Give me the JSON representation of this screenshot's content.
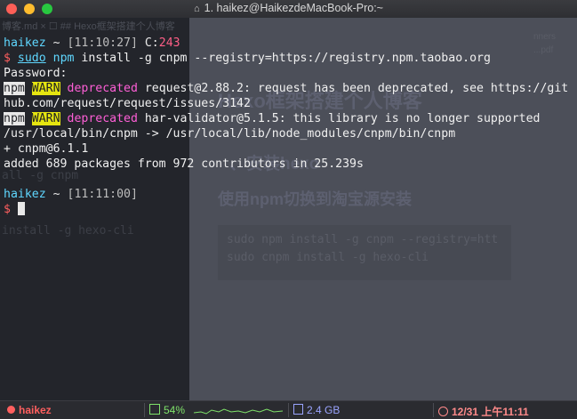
{
  "window": {
    "title": "1. haikez@HaikezdeMacBook-Pro:~",
    "home_icon": "house-icon"
  },
  "background_editor": {
    "tab_text": "博客.md ×   ☐ ## Hexo框架搭建个人博客",
    "right_top_small": "nners",
    "right_top_small2": "...pdf",
    "heading1": "Hexo框架搭建个人博客",
    "heading2": "、安装hexo",
    "heading3": "使用npm切换到淘宝源安装",
    "code_line1": "sudo npm install -g cnpm --registry=htt",
    "code_line2": "sudo cnpm install -g hexo-cli",
    "left_fragment1": "all -g cnpm",
    "left_fragment2": "install -g hexo-cli"
  },
  "terminal": {
    "prompt1": {
      "user": "haikez",
      "path": "~",
      "time": "[11:10:27]",
      "c_label": "C:",
      "c_value": "243"
    },
    "command": {
      "dollar": "$",
      "sudo": "sudo",
      "npm": "npm",
      "rest": " install -g cnpm --registry=https://registry.npm.taobao.org"
    },
    "password": "Password:",
    "warn1": {
      "npm": "npm",
      "level": "WARN",
      "tag": "deprecated",
      "msg_a": " request@2.88.2: request has been deprecated, see https://git",
      "msg_b": "hub.com/request/request/issues/3142"
    },
    "warn2": {
      "npm": "npm",
      "level": "WARN",
      "tag": "deprecated",
      "msg": " har-validator@5.1.5: this library is no longer supported"
    },
    "link_line": "/usr/local/bin/cnpm -> /usr/local/lib/node_modules/cnpm/bin/cnpm",
    "installed_line": "+ cnpm@6.1.1",
    "added_line": "added 689 packages from 972 contributors in 25.239s",
    "prompt2": {
      "user": "haikez",
      "path": "~",
      "time": "[11:11:00]"
    },
    "prompt_dollar": "$"
  },
  "statusbar": {
    "user": "haikez",
    "cpu": "54%",
    "memory": "2.4 GB",
    "datetime": "12/31 上午11:11",
    "colors": {
      "user": "#ff5f5f",
      "cpu": "#7fe36a",
      "memory": "#9aa4ff",
      "date": "#ff8a8a"
    }
  }
}
